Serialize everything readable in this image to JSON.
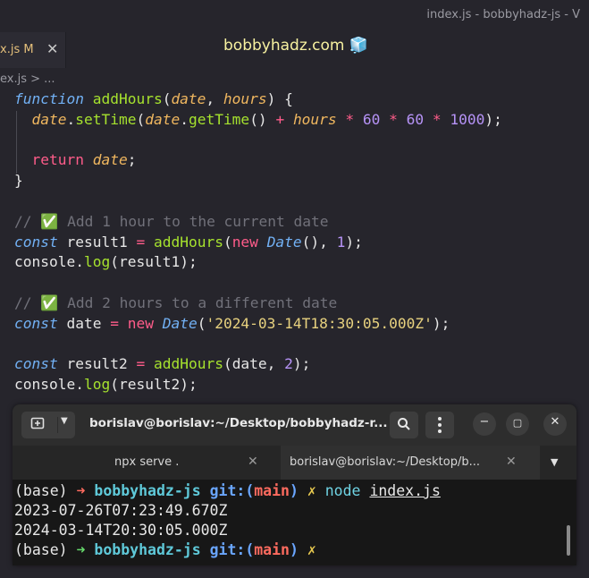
{
  "window": {
    "title": "index.js - bobbyhadz-js - V"
  },
  "tab": {
    "label": "x.js M",
    "close": "✕"
  },
  "brand": {
    "text": "bobbyhadz.com 🧊"
  },
  "breadcrumb": {
    "text": "ex.js > ..."
  },
  "code": {
    "l1": {
      "kw": "function",
      "fn": "addHours",
      "p1": "date",
      "p2": "hours"
    },
    "l2": {
      "p": "date",
      "set": "setTime",
      "p2": "date",
      "get": "getTime",
      "hours": "hours",
      "n1": "60",
      "n2": "60",
      "n3": "1000"
    },
    "l4": {
      "ret": "return",
      "p": "date"
    },
    "l7": {
      "comment": "// ✅ Add 1 hour to the current date"
    },
    "l8": {
      "kw": "const",
      "name": "result1",
      "fn": "addHours",
      "new": "new",
      "cls": "Date",
      "n": "1"
    },
    "l9": {
      "console": "console",
      "log": "log",
      "arg": "result1"
    },
    "l11": {
      "comment": "// ✅ Add 2 hours to a different date"
    },
    "l12": {
      "kw": "const",
      "name": "date",
      "new": "new",
      "cls": "Date",
      "str": "'2024-03-14T18:30:05.000Z'"
    },
    "l14": {
      "kw": "const",
      "name": "result2",
      "fn": "addHours",
      "arg": "date",
      "n": "2"
    },
    "l15": {
      "console": "console",
      "log": "log",
      "arg": "result2"
    }
  },
  "terminal": {
    "title": "borislav@borislav:~/Desktop/bobbyhadz-r...",
    "tabs": [
      {
        "label": "npx serve .",
        "close": "✕"
      },
      {
        "label": "borislav@borislav:~/Desktop/b...",
        "close": "✕"
      }
    ],
    "prompt": {
      "base": "(base)",
      "arrow": "➜",
      "dir": "bobbyhadz-js",
      "git": "git:(",
      "branch": "main",
      "git_close": ")",
      "x": "✗"
    },
    "command": {
      "cmd": "node",
      "arg": "index.js"
    },
    "output": [
      "2023-07-26T07:23:49.670Z",
      "2024-03-14T20:30:05.000Z"
    ]
  }
}
